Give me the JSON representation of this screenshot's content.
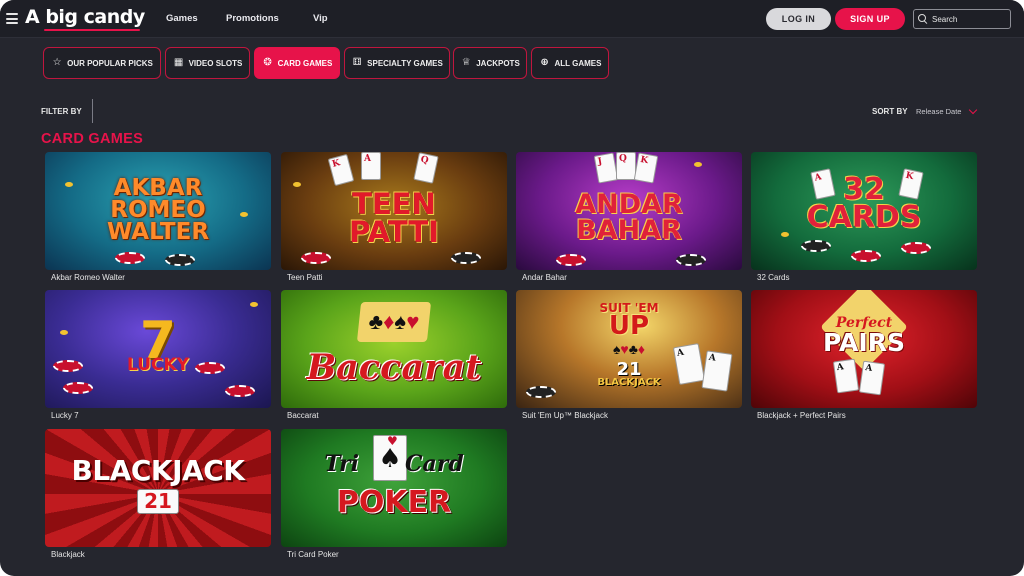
{
  "header": {
    "logo": "A big candy",
    "nav": [
      "Games",
      "Promotions",
      "Vip"
    ],
    "login_label": "LOG IN",
    "signup_label": "SIGN UP",
    "search_placeholder": "Search"
  },
  "tabs": [
    {
      "label": "OUR POPULAR PICKS",
      "icon": "star-badge-icon",
      "active": false
    },
    {
      "label": "VIDEO SLOTS",
      "icon": "slot-machine-icon",
      "active": false
    },
    {
      "label": "CARD GAMES",
      "icon": "poker-chip-icon",
      "active": true
    },
    {
      "label": "SPECIALTY GAMES",
      "icon": "dice-icon",
      "active": false
    },
    {
      "label": "JACKPOTS",
      "icon": "trophy-icon",
      "active": false
    },
    {
      "label": "ALL GAMES",
      "icon": "plus-circle-icon",
      "active": false
    }
  ],
  "filter": {
    "label": "FILTER BY"
  },
  "sort": {
    "label": "SORT BY",
    "value": "Release Date"
  },
  "section_title": "CARD GAMES",
  "games": [
    {
      "name": "Akbar Romeo Walter",
      "art_lines": [
        "AKBAR",
        "ROMEO",
        "WALTER"
      ]
    },
    {
      "name": "Teen Patti",
      "art_lines": [
        "TEEN",
        "PATTI"
      ]
    },
    {
      "name": "Andar Bahar",
      "art_lines": [
        "ANDAR",
        "BAHAR"
      ]
    },
    {
      "name": "32 Cards",
      "art_lines": [
        "32",
        "CARDS"
      ]
    },
    {
      "name": "Lucky 7",
      "art_lines": [
        "7",
        "LUCKY"
      ]
    },
    {
      "name": "Baccarat",
      "art_lines": [
        "Baccarat"
      ]
    },
    {
      "name": "Suit 'Em Up™ Blackjack",
      "art_lines": [
        "SUIT 'EM",
        "UP",
        "21",
        "BLACKJACK"
      ]
    },
    {
      "name": "Blackjack + Perfect Pairs",
      "art_lines": [
        "Perfect",
        "PAIRS"
      ]
    },
    {
      "name": "Blackjack",
      "art_lines": [
        "BLACKJACK",
        "21"
      ]
    },
    {
      "name": "Tri Card Poker",
      "art_lines": [
        "Tri",
        "Card",
        "POKER"
      ]
    }
  ],
  "colors": {
    "accent": "#e7134a",
    "background": "#25262e",
    "header": "#1e1f26"
  }
}
